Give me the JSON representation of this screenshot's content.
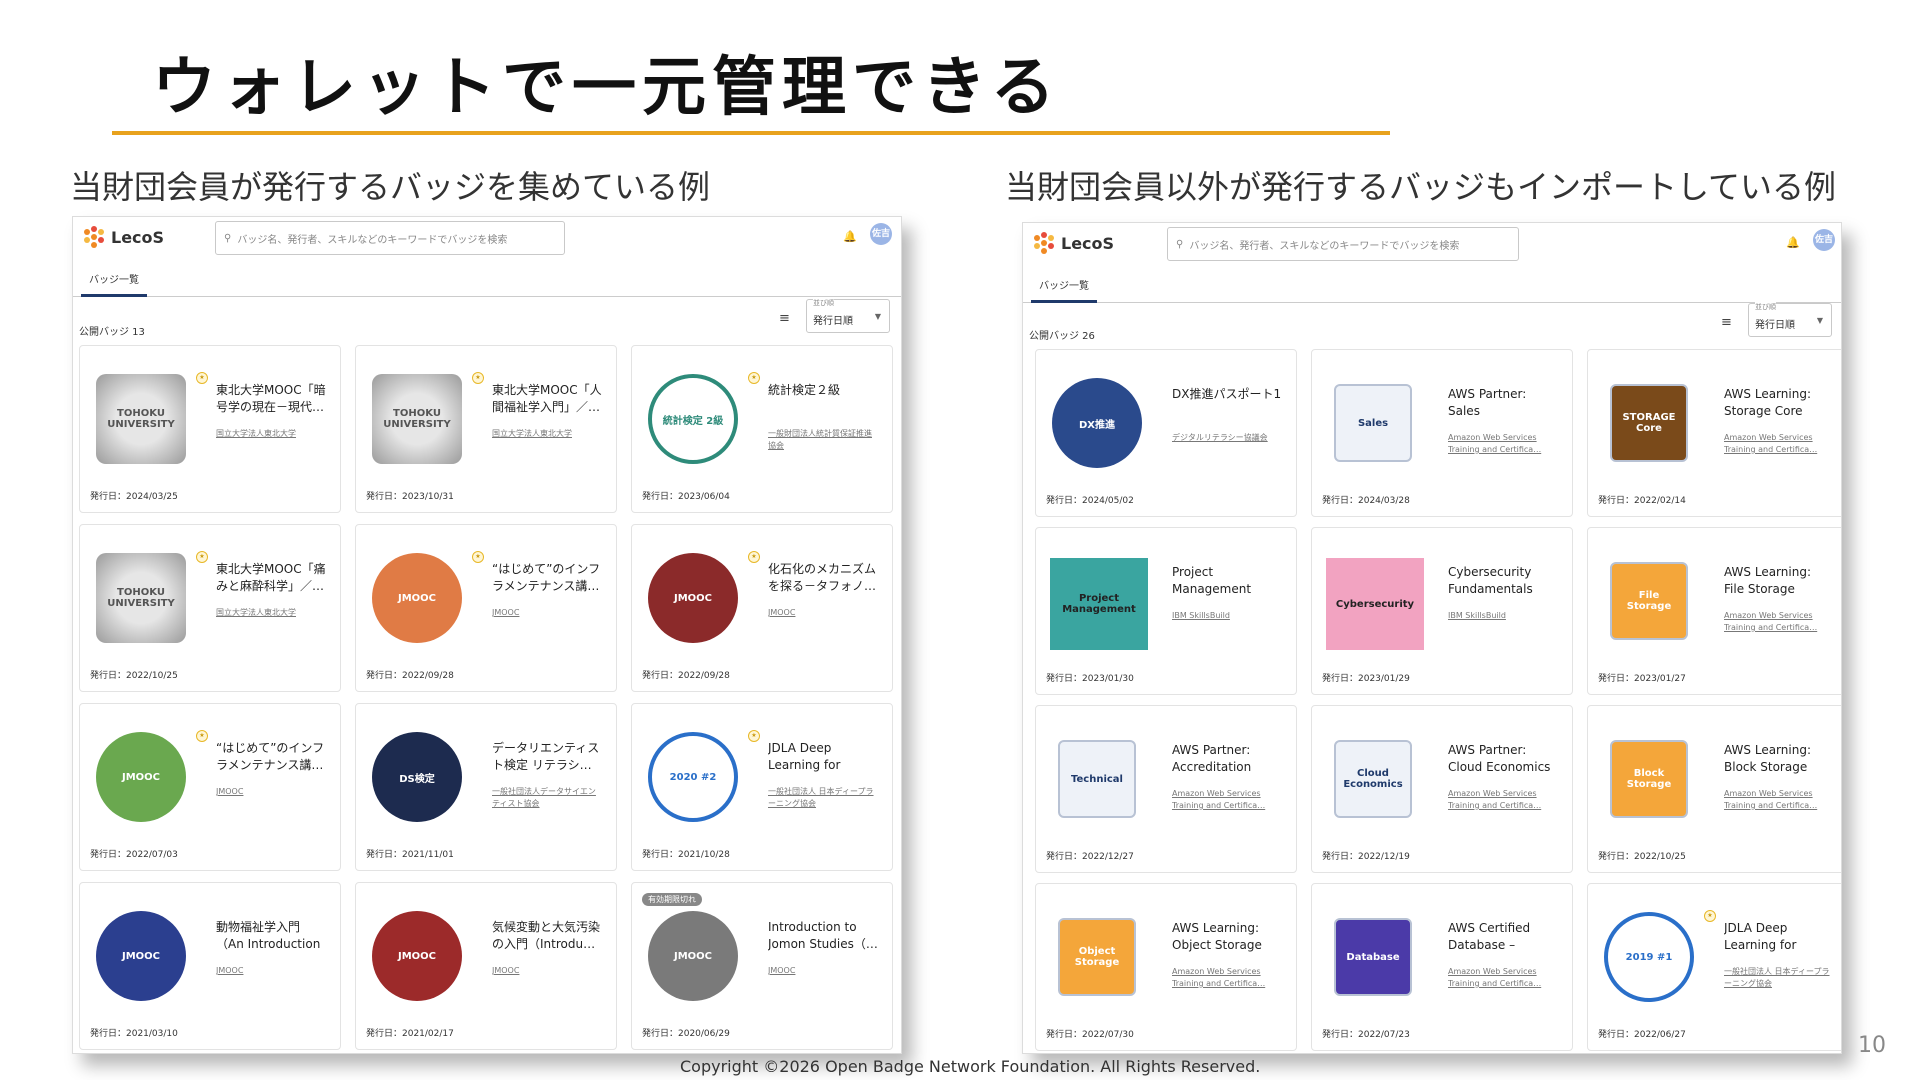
{
  "slide": {
    "title": "ウォレットで一元管理できる",
    "caption_left": "当財団会員が発行するバッジを集めている例",
    "caption_right": "当財団会員以外が発行するバッジもインポートしている例",
    "footer": "Copyright ©2026 Open Badge Network Foundation. All Rights Reserved.",
    "page_number": "10",
    "accent_color": "#e8a21d"
  },
  "left_app": {
    "logo": "LecoS",
    "search_placeholder": "バッジ名、発行者、スキルなどのキーワードでバッジを検索",
    "avatar": "佐吉",
    "tab": "バッジ一覧",
    "count_label": "公開バッジ 13",
    "sort_label": "並び順",
    "sort_value": "発行日順",
    "cards": [
      {
        "name": "東北大学MOOC「暗号学の現在－現代…",
        "issuer": "国立大学法人東北大学",
        "date": "発行日：2024/03/25",
        "icon": "tohoku-badge",
        "starred": true,
        "color": "#a9a9a9",
        "badge_text": "TOHOKU UNIVERSITY"
      },
      {
        "name": "東北大学MOOC「人間福祉学入門」／…",
        "issuer": "国立大学法人東北大学",
        "date": "発行日：2023/10/31",
        "icon": "tohoku-badge",
        "starred": true,
        "color": "#a9a9a9",
        "badge_text": "TOHOKU UNIVERSITY"
      },
      {
        "name": "統計検定２級",
        "issuer": "一般財団法人統計質保証推進協会",
        "date": "発行日：2023/06/04",
        "icon": "jssc-badge",
        "starred": true,
        "color": "#2e8b7a",
        "badge_text": "統計検定 2級"
      },
      {
        "name": "東北大学MOOC「痛みと麻酔科学」／…",
        "issuer": "国立大学法人東北大学",
        "date": "発行日：2022/10/25",
        "icon": "tohoku-badge",
        "starred": true,
        "color": "#a9a9a9",
        "badge_text": "TOHOKU UNIVERSITY"
      },
      {
        "name": "“はじめて”のインフラメンテナンス講…",
        "issuer": "JMOOC",
        "date": "発行日：2022/09/28",
        "icon": "jmooc-badge",
        "starred": true,
        "color": "#e07b45",
        "badge_text": "JMOOC"
      },
      {
        "name": "化石化のメカニズムを探る－タフォノ…",
        "issuer": "JMOOC",
        "date": "発行日：2022/09/28",
        "icon": "jmooc-badge",
        "starred": true,
        "color": "#8b2a2a",
        "badge_text": "JMOOC"
      },
      {
        "name": "“はじめて”のインフラメンテナンス講…",
        "issuer": "JMOOC",
        "date": "発行日：2022/07/03",
        "icon": "jmooc-badge",
        "starred": true,
        "color": "#6aa84f",
        "badge_text": "JMOOC"
      },
      {
        "name": "データリエンティスト検定 リテラシ…",
        "issuer": "一般社団法人データサイエンティスト協会",
        "date": "発行日：2021/11/01",
        "icon": "ds-badge",
        "starred": false,
        "color": "#1d2b4f",
        "badge_text": "DS検定"
      },
      {
        "name": "JDLA Deep Learning for GENERA…",
        "issuer": "一般社団法人 日本ディープラーニング協会",
        "date": "発行日：2021/10/28",
        "icon": "jdla-badge",
        "starred": true,
        "color": "#2a6fc9",
        "badge_text": "2020 #2"
      },
      {
        "name": "動物福祉学入門（An Introduction …",
        "issuer": "JMOOC",
        "date": "発行日：2021/03/10",
        "icon": "jmooc-badge",
        "starred": false,
        "color": "#2b3f8f",
        "badge_text": "JMOOC"
      },
      {
        "name": "気候変動と大気汚染の入門（Introdu…",
        "issuer": "JMOOC",
        "date": "発行日：2021/02/17",
        "icon": "jmooc-badge",
        "starred": false,
        "color": "#9c2a2a",
        "badge_text": "JMOOC"
      },
      {
        "name": "Introduction to Jomon Studies（…",
        "issuer": "JMOOC",
        "date": "発行日：2020/06/29",
        "icon": "jmooc-badge",
        "starred": false,
        "color": "#7a7a7a",
        "badge_text": "JMOOC",
        "expired": "有効期限切れ"
      }
    ]
  },
  "right_app": {
    "logo": "LecoS",
    "search_placeholder": "バッジ名、発行者、スキルなどのキーワードでバッジを検索",
    "avatar": "佐吉",
    "tab": "バッジ一覧",
    "count_label": "公開バッジ 26",
    "sort_label": "並び順",
    "sort_value": "発行日順",
    "cards": [
      {
        "name": "DX推進パスポート1",
        "issuer": "デジタルリテラシー協議会",
        "date": "発行日：2024/05/02",
        "icon": "dx-badge",
        "color": "#2a4a8c",
        "badge_text": "DX推進"
      },
      {
        "name": "AWS Partner: Sales Accreditatio…",
        "issuer": "Amazon Web Services Training and Certifica…",
        "date": "発行日：2024/03/28",
        "icon": "aws-badge",
        "color": "#eef2f8",
        "badge_text": "Sales"
      },
      {
        "name": "AWS Learning: Storage Core",
        "issuer": "Amazon Web Services Training and Certifica…",
        "date": "発行日：2022/02/14",
        "icon": "aws-badge",
        "color": "#7a4a1a",
        "badge_text": "STORAGE Core"
      },
      {
        "name": "Project Management Fundament…",
        "issuer": "IBM SkillsBuild",
        "date": "発行日：2023/01/30",
        "icon": "ibm-badge",
        "color": "#3aa5a0",
        "badge_text": "Project Management"
      },
      {
        "name": "Cybersecurity Fundamentals",
        "issuer": "IBM SkillsBuild",
        "date": "発行日：2023/01/29",
        "icon": "ibm-badge",
        "color": "#f2a3c1",
        "badge_text": "Cybersecurity"
      },
      {
        "name": "AWS Learning: File Storage",
        "issuer": "Amazon Web Services Training and Certifica…",
        "date": "発行日：2023/01/27",
        "icon": "aws-badge",
        "color": "#f4a63a",
        "badge_text": "File Storage"
      },
      {
        "name": "AWS Partner: Accreditation (Tec…",
        "issuer": "Amazon Web Services Training and Certifica…",
        "date": "発行日：2022/12/27",
        "icon": "aws-badge",
        "color": "#eef2f8",
        "badge_text": "Technical"
      },
      {
        "name": "AWS Partner: Cloud Economics A…",
        "issuer": "Amazon Web Services Training and Certifica…",
        "date": "発行日：2022/12/19",
        "icon": "aws-badge",
        "color": "#eef2f8",
        "badge_text": "Cloud Economics"
      },
      {
        "name": "AWS Learning: Block Storage",
        "issuer": "Amazon Web Services Training and Certifica…",
        "date": "発行日：2022/10/25",
        "icon": "aws-badge",
        "color": "#f4a63a",
        "badge_text": "Block Storage"
      },
      {
        "name": "AWS Learning: Object Storage",
        "issuer": "Amazon Web Services Training and Certifica…",
        "date": "発行日：2022/07/30",
        "icon": "aws-badge",
        "color": "#f4a63a",
        "badge_text": "Object Storage"
      },
      {
        "name": "AWS Certified Database – Specia…",
        "issuer": "Amazon Web Services Training and Certifica…",
        "date": "発行日：2022/07/23",
        "icon": "aws-badge",
        "color": "#4b3aa8",
        "badge_text": "Database"
      },
      {
        "name": "JDLA Deep Learning for GENERA…",
        "issuer": "一般社団法人 日本ディープラーニング協会",
        "date": "発行日：2022/06/27",
        "icon": "jdla-badge",
        "color": "#2a6fc9",
        "badge_text": "2019 #1",
        "starred": true
      }
    ]
  }
}
